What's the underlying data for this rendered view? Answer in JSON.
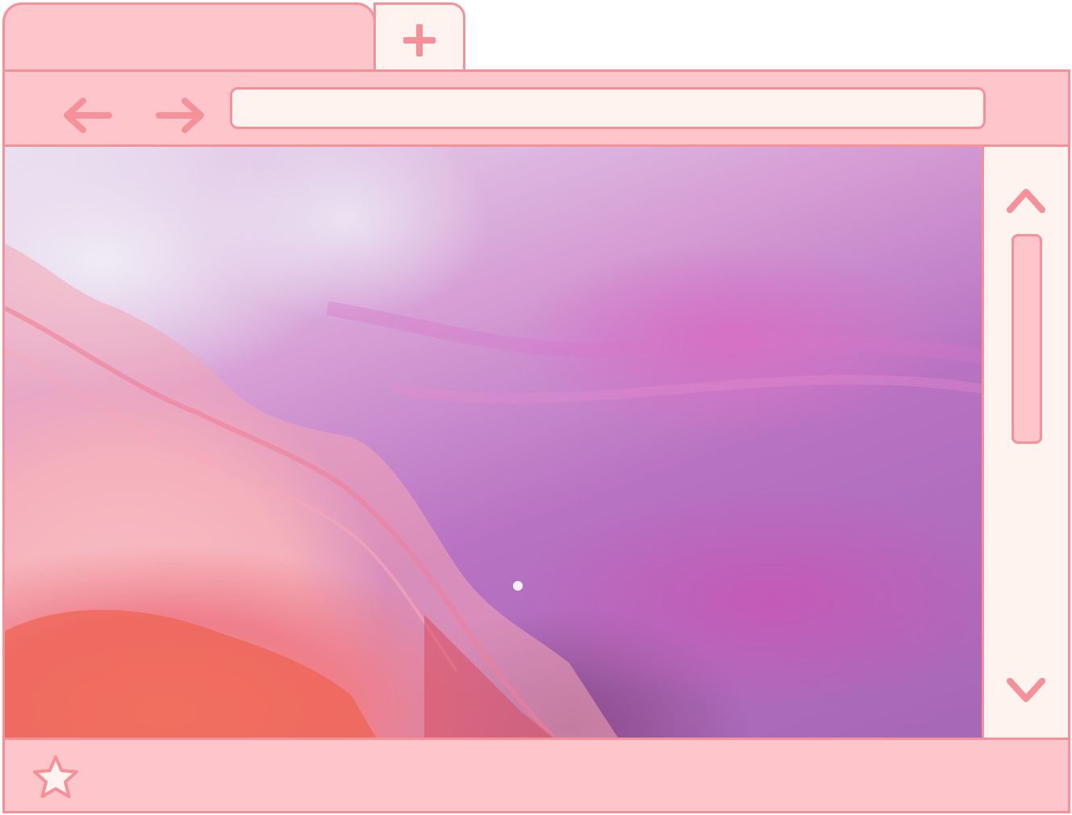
{
  "tabs": [
    {
      "label": ""
    }
  ],
  "new_tab": {
    "icon": "plus-icon"
  },
  "toolbar": {
    "back_icon": "arrow-left-icon",
    "forward_icon": "arrow-right-icon",
    "address": {
      "value": ""
    }
  },
  "content": {
    "image": "abstract-pink-purple-fluid-art"
  },
  "scrollbar": {
    "up_icon": "chevron-up-icon",
    "down_icon": "chevron-down-icon"
  },
  "statusbar": {
    "bookmark_icon": "star-icon"
  },
  "colors": {
    "frame": "#fec6ca",
    "border": "#f6919a",
    "light": "#fff3ef",
    "accent": "#f6919a"
  }
}
